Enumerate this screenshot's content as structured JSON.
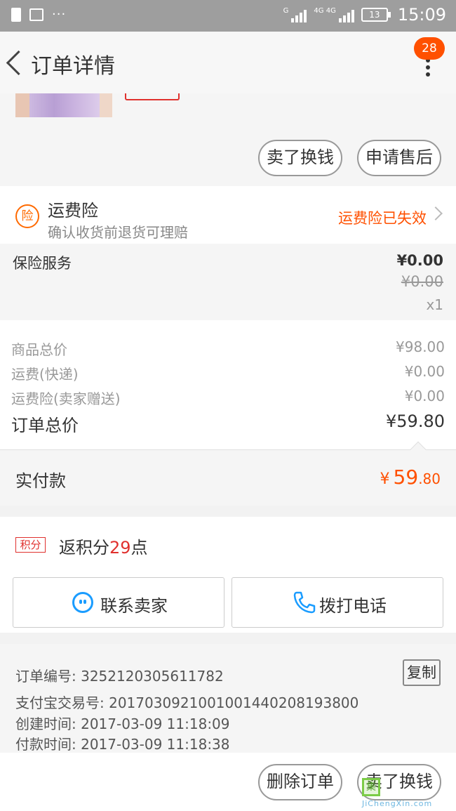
{
  "status_bar": {
    "signal_1_label": "G",
    "signal_2_label": "4G 4G",
    "battery": "13",
    "time": "15:09",
    "more": "···"
  },
  "header": {
    "title": "订单详情",
    "badge_count": "28"
  },
  "product": {
    "sell_button": "卖了换钱",
    "after_sale_button": "申请售后"
  },
  "freight_insurance": {
    "icon_text": "险",
    "title": "运费险",
    "subtitle": "确认收货前退货可理赔",
    "status": "运费险已失效"
  },
  "insurance_service": {
    "name": "保险服务",
    "price": "¥0.00",
    "original_price": "¥0.00",
    "quantity": "x1"
  },
  "totals": {
    "rows": [
      {
        "label": "商品总价",
        "value": "¥98.00"
      },
      {
        "label": "运费(快递)",
        "value": "¥0.00"
      },
      {
        "label": "运费险(卖家赠送)",
        "value": "¥0.00"
      }
    ],
    "order_total_label": "订单总价",
    "order_total_value": "¥59.80"
  },
  "paid": {
    "label": "实付款",
    "currency": "¥",
    "integer": "59",
    "decimal": ".80"
  },
  "points": {
    "tag": "积分",
    "prefix": "返积分",
    "value": "29",
    "suffix": "点"
  },
  "contact": {
    "seller_button": "联系卖家",
    "call_button": "拨打电话"
  },
  "order_info": {
    "order_no": "订单编号: 3252120305611782",
    "alipay_no": "支付宝交易号: 2017030921001001440208193800",
    "created": "创建时间: 2017-03-09 11:18:09",
    "paid_time": "付款时间: 2017-03-09 11:18:38",
    "copy_button": "复制"
  },
  "bottom_bar": {
    "delete_button": "删除订单",
    "sell_button": "卖了换钱"
  },
  "watermark": {
    "text": "JiChengXin.com",
    "badge": "集"
  },
  "colors": {
    "accent": "#ff5000",
    "points": "#e0312e",
    "contact_icon": "#1a9cff"
  }
}
